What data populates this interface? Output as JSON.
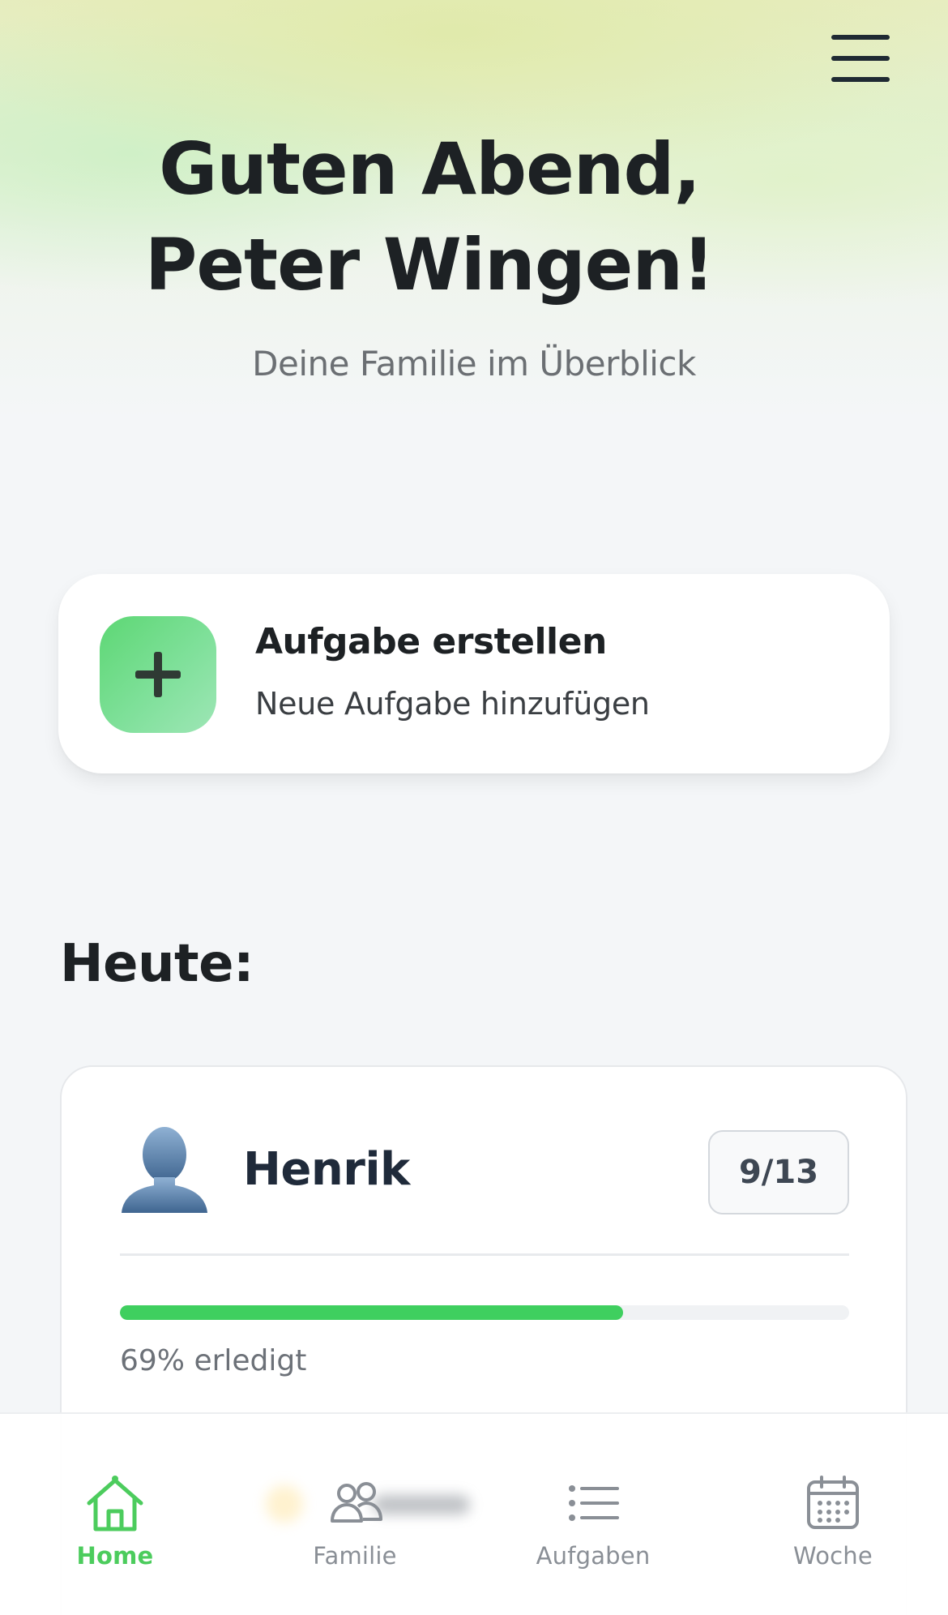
{
  "header": {
    "greeting": "Guten Abend, Peter Wingen!",
    "subtitle": "Deine Familie im Überblick",
    "menu_icon": "hamburger-menu-icon"
  },
  "create_task": {
    "title": "Aufgabe erstellen",
    "subtitle": "Neue Aufgabe hinzufügen",
    "icon": "plus-icon",
    "icon_color": "#5dd774"
  },
  "today": {
    "title": "Heute:",
    "members": [
      {
        "name": "Henrik",
        "avatar_icon": "person-silhouette-icon",
        "count": "9/13",
        "progress_percent": 69,
        "progress_text": "69% erledigt"
      }
    ]
  },
  "bottom_nav": {
    "items": [
      {
        "label": "Home",
        "icon": "home-icon",
        "active": true
      },
      {
        "label": "Familie",
        "icon": "family-icon",
        "active": false
      },
      {
        "label": "Aufgaben",
        "icon": "list-icon",
        "active": false
      },
      {
        "label": "Woche",
        "icon": "calendar-icon",
        "active": false
      }
    ]
  },
  "colors": {
    "accent": "#4ccc5d",
    "progress": "#3fcf5f",
    "text_dark": "#1d2124",
    "text_muted": "#8a8f96"
  }
}
